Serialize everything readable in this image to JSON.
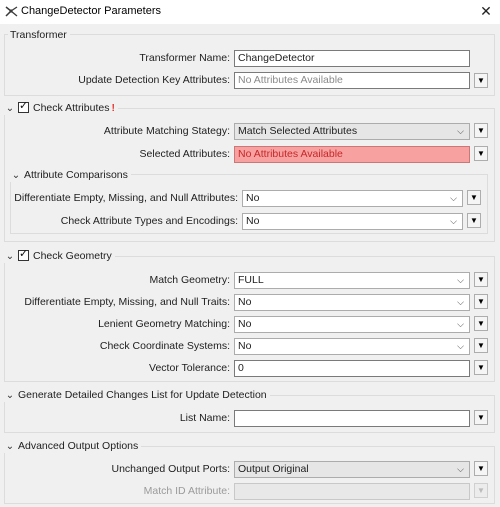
{
  "window": {
    "title": "ChangeDetector Parameters",
    "close_icon": "close-icon",
    "app_icon": "transformer-icon"
  },
  "transformer": {
    "section_title": "Transformer",
    "name_label": "Transformer Name:",
    "name_value": "ChangeDetector",
    "update_key_label": "Update Detection Key Attributes:",
    "update_key_placeholder": "No Attributes Available"
  },
  "check_attributes": {
    "section_title": "Check Attributes",
    "checked": true,
    "warning": "!",
    "matching_label": "Attribute Matching Stategy:",
    "matching_value": "Match Selected Attributes",
    "selected_label": "Selected Attributes:",
    "selected_placeholder": "No Attributes Available",
    "comparisons": {
      "section_title": "Attribute Comparisons",
      "diff_label": "Differentiate Empty, Missing, and Null Attributes:",
      "diff_value": "No",
      "types_label": "Check Attribute Types and Encodings:",
      "types_value": "No"
    }
  },
  "check_geometry": {
    "section_title": "Check Geometry",
    "checked": true,
    "match_label": "Match Geometry:",
    "match_value": "FULL",
    "diff_label": "Differentiate Empty, Missing, and Null Traits:",
    "diff_value": "No",
    "lenient_label": "Lenient Geometry Matching:",
    "lenient_value": "No",
    "coord_label": "Check Coordinate Systems:",
    "coord_value": "No",
    "tolerance_label": "Vector Tolerance:",
    "tolerance_value": "0"
  },
  "changes_list": {
    "section_title": "Generate Detailed Changes List for Update Detection",
    "list_label": "List Name:",
    "list_value": ""
  },
  "advanced": {
    "section_title": "Advanced Output Options",
    "ports_label": "Unchanged Output Ports:",
    "ports_value": "Output Original",
    "match_id_label": "Match ID Attribute:",
    "match_id_value": ""
  }
}
